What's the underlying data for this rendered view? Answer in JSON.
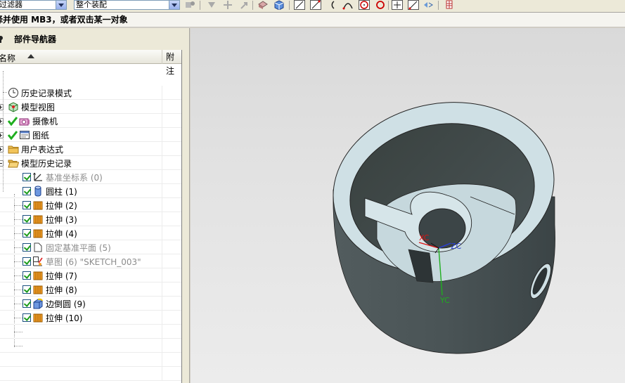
{
  "toolbar": {
    "filter_value": "过滤器",
    "assembly_value": "整个装配"
  },
  "status": {
    "text": "择并使用 MB3，或者双击某一对象"
  },
  "navigator": {
    "title": "部件导航器",
    "columns": {
      "name": "名称",
      "notes": "附注"
    },
    "items": [
      {
        "label": "历史记录模式",
        "icon": "clock-icon",
        "dim": false
      },
      {
        "label": "模型视图",
        "icon": "model-view-icon",
        "dim": false
      },
      {
        "label": "摄像机",
        "icon": "camera-icon",
        "dim": false
      },
      {
        "label": "图纸",
        "icon": "drawing-icon",
        "dim": false
      },
      {
        "label": "用户表达式",
        "icon": "folder-icon",
        "dim": false
      },
      {
        "label": "模型历史记录",
        "icon": "folder-open-icon",
        "dim": false
      },
      {
        "label": "基准坐标系 (0)",
        "icon": "datum-csys-icon",
        "dim": true
      },
      {
        "label": "圆柱 (1)",
        "icon": "cylinder-icon",
        "dim": false
      },
      {
        "label": "拉伸 (2)",
        "icon": "extrude-icon",
        "dim": false
      },
      {
        "label": "拉伸 (3)",
        "icon": "extrude-icon",
        "dim": false
      },
      {
        "label": "拉伸 (4)",
        "icon": "extrude-icon",
        "dim": false
      },
      {
        "label": "固定基准平面 (5)",
        "icon": "datum-plane-icon",
        "dim": true
      },
      {
        "label": "草图 (6) \"SKETCH_003\"",
        "icon": "sketch-icon",
        "dim": true
      },
      {
        "label": "拉伸 (7)",
        "icon": "extrude-icon",
        "dim": false
      },
      {
        "label": "拉伸 (8)",
        "icon": "extrude-icon",
        "dim": false
      },
      {
        "label": "边倒圆 (9)",
        "icon": "edge-blend-icon",
        "dim": false
      },
      {
        "label": "拉伸 (10)",
        "icon": "extrude-icon",
        "dim": false
      }
    ]
  },
  "viewport": {
    "axes": {
      "x": "XC",
      "y": "YC",
      "z": "ZC"
    },
    "model_body_color": "#4a5456",
    "model_face_color": "#cfe0e5"
  }
}
